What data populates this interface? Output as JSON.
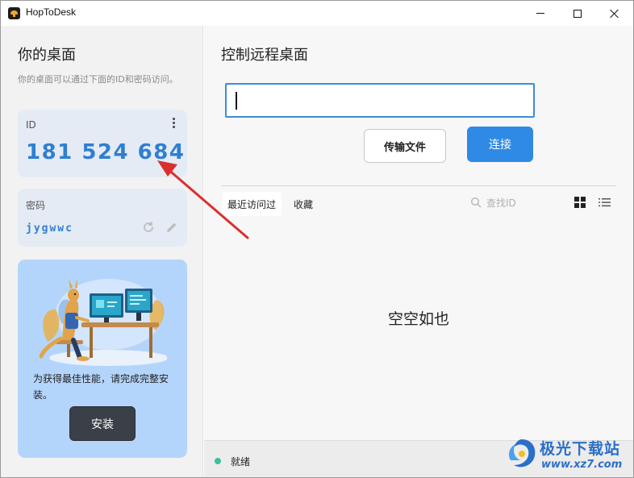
{
  "window": {
    "title": "HopToDesk",
    "controls": [
      "minimize",
      "maximize",
      "close"
    ]
  },
  "sidebar": {
    "title": "你的桌面",
    "description": "你的桌面可以通过下面的ID和密码访问。",
    "id_card": {
      "label": "ID",
      "value": "181 524 684",
      "menu_icon": "kebab-menu-icon"
    },
    "password_card": {
      "label": "密码",
      "value": "jygwwc",
      "refresh_icon": "refresh-icon",
      "edit_icon": "pencil-icon"
    },
    "install_card": {
      "message": "为获得最佳性能，请完成完整安装。",
      "button_label": "安装"
    }
  },
  "main": {
    "title": "控制远程桌面",
    "id_input": {
      "value": "",
      "placeholder": ""
    },
    "transfer_button": "传输文件",
    "connect_button": "连接",
    "tabs": [
      {
        "label": "最近访问过",
        "active": true
      },
      {
        "label": "收藏",
        "active": false
      }
    ],
    "search_placeholder": "查找ID",
    "view_icons": [
      "grid-view-icon",
      "list-view-icon"
    ],
    "empty_text": "空空如也"
  },
  "statusbar": {
    "text": "就绪",
    "indicator_color": "#37c29b"
  },
  "watermark": {
    "name": "极光下载站",
    "url": "www.xz7.com"
  },
  "colors": {
    "accent": "#2f8ae6",
    "id_text": "#2f7fd1",
    "card_bg": "#e4ebf5",
    "install_card_bg": "#b4d5fb",
    "annotation_arrow": "#d9302f"
  }
}
